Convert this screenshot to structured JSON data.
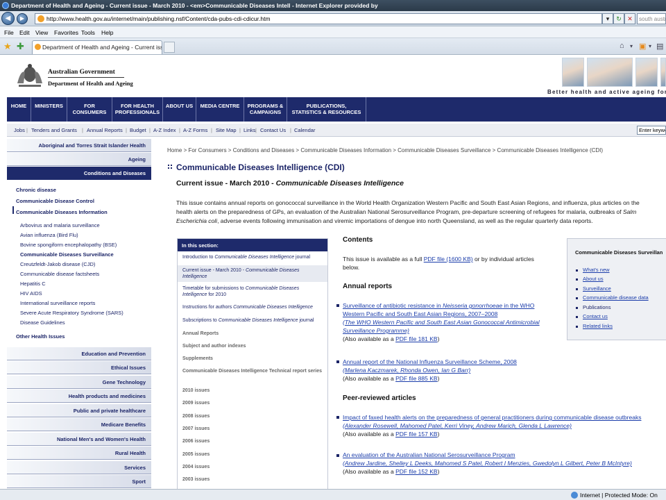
{
  "browser": {
    "title": "Department of Health and Ageing - Current issue - March 2010 - <em>Communicable Diseases Intell - Internet Explorer provided by",
    "url": "http://www.health.gov.au/internet/main/publishing.nsf/Content/cda-pubs-cdi-cdicur.htm",
    "search_placeholder": "south austra",
    "menu": [
      "File",
      "Edit",
      "View",
      "Favorites",
      "Tools",
      "Help"
    ],
    "tab_label": "Department of Health and Ageing - Current issue...",
    "status_zone": "Internet | Protected Mode: On"
  },
  "header": {
    "gov_line1": "Australian Government",
    "gov_line2": "Department of Health and Ageing",
    "tagline": "Better health and active ageing for"
  },
  "mainnav": [
    "HOME",
    "MINISTERS",
    "FOR\nCONSUMERS",
    "FOR HEALTH\nPROFESSIONALS",
    "ABOUT US",
    "MEDIA CENTRE",
    "PROGRAMS &\nCAMPAIGNS",
    "PUBLICATIONS,\nSTATISTICS & RESOURCES"
  ],
  "subnav": [
    "Jobs",
    "Tenders and Grants",
    "Annual Reports",
    "Budget",
    "A-Z Index",
    "A-Z Forms",
    "Site Map",
    "Links",
    "Contact Us",
    "Calendar"
  ],
  "keyword_placeholder": "Enter keywords",
  "sidebar": {
    "top_tabs": [
      "Aboriginal and Torres Strait Islander Health",
      "Ageing",
      "Conditions and Diseases"
    ],
    "level1_top": [
      "Chronic disease",
      "Communicable Disease Control",
      "Communicable Diseases Information"
    ],
    "level2": [
      "Arbovirus and malaria surveillance",
      "Avian influenza (Bird Flu)",
      "Bovine spongiform encephalopathy (BSE)",
      "Communicable Diseases Surveillance",
      "Creutzfeldt-Jakob disease (CJD)",
      "Communicable disease factsheets",
      "Hepatitis C",
      "HIV AIDS",
      "International surveillance reports",
      "Severe Acute Respiratory Syndrome (SARS)",
      "Disease Guidelines"
    ],
    "level1_bottom": "Other Health Issues",
    "bottom_tabs": [
      "Education and Prevention",
      "Ethical Issues",
      "Gene Technology",
      "Health products and medicines",
      "Public and private healthcare",
      "Medicare Benefits",
      "National Men's and Women's Health",
      "Rural Health",
      "Services",
      "Sport"
    ]
  },
  "content": {
    "breadcrumb": "Home > For Consumers > Conditions and Diseases > Communicable Diseases Information > Communicable Diseases Surveillance > Communicable Diseases Intelligence (CDI)",
    "title": "Communicable Diseases Intelligence (CDI)",
    "subtitle_plain": "Current issue - March 2010 - ",
    "subtitle_italic": "Communicable Diseases Intelligence",
    "intro_1": "This issue contains annual reports on gonococcal surveillance in the World Health Organization Western Pacific and South East Asian Regions, and influenza, plus articles on the",
    "intro_2": "health alerts on the preparedness of GPs, an evaluation of the Australian National Serosurveillance Program, pre-departure screening of refugees for malaria, outbreaks of ",
    "intro_2_italic": "Salm",
    "intro_3_italic": "Escherichia coli",
    "intro_3": ", adverse events following immunisation and viremic importations of dengue into north Queensland, as well as the regular quarterly data reports."
  },
  "section_box": {
    "heading": "In this section:",
    "items": [
      {
        "plain": "Introduction to ",
        "italic": "Communicable Diseases Intelligence",
        "rest": " journal"
      },
      {
        "plain": "Current issue - March 2010 - ",
        "italic": "Communicable Diseases Intelligence",
        "rest": ""
      },
      {
        "plain": "Timetable for submissions to ",
        "italic": "Communicable Diseases Intelligence",
        "rest": " for 2010"
      },
      {
        "plain": "Instructions for authors ",
        "italic": "Communicable Diseases Intelligence",
        "rest": ""
      },
      {
        "plain": "Subscriptions to ",
        "italic": "Communicable Diseases Intelligence",
        "rest": " journal"
      }
    ],
    "grey_items": [
      "Annual Reports",
      "Subject and author indexes",
      "Supplements",
      "Communicable Diseases Intelligence Technical report series",
      "2010 issues",
      "2009 issues",
      "2008 issues",
      "2007 issues",
      "2006 issues",
      "2005 issues",
      "2004 issues",
      "2003 issues"
    ]
  },
  "contents": {
    "heading": "Contents",
    "para_1": "This issue is available as a full ",
    "para_link": "PDF file (1600 KB)",
    "para_2": " or by individual articles below.",
    "annual_heading": "Annual reports",
    "peer_heading": "Peer-reviewed articles",
    "articles": [
      {
        "title_pre": "Surveillance of antibiotic resistance in ",
        "title_italic": "Neisseria gonorrhoeae",
        "title_post": " in the WHO",
        "title_line2": "Western Pacific and South East Asian Regions, 2007–2008",
        "authors_1": "(The WHO Western Pacific and South East Asian Gonococcal Antimicrobial",
        "authors_2": "Surveillance Programme)",
        "also": "(Also available as a ",
        "pdf": "PDF file 181 KB",
        "close": ")"
      },
      {
        "title": "Annual report of the National Influenza Surveillance Scheme, 2008",
        "authors": "(Marlena Kaczmarek, Rhonda Owen, Ian G Barr)",
        "also": "(Also available as a ",
        "pdf": "PDF file 885 KB",
        "close": ")"
      },
      {
        "title": "Impact of faxed health alerts on the preparedness of general practitioners during communicable disease outbreaks",
        "authors": "(Alexander Rosewell, Mahomed Patel, Kerri Viney, Andrew Marich, Glenda L Lawrence)",
        "also": "(Also available as a ",
        "pdf": "PDF file 157 KB",
        "close": ")"
      },
      {
        "title": "An evaluation of the Australian National Serosurveillance Program",
        "authors": "(Andrew Jardine, Shelley L Deeks, Mahomed S Patel, Robert I Menzies, Gwedolyn L Gilbert, Peter B McIntyre)",
        "also": "(Also available as a ",
        "pdf": "PDF file 152 KB",
        "close": ")"
      }
    ]
  },
  "right_box": {
    "heading": "Communicable Diseases Surveillan",
    "links": [
      "What's new",
      "About us",
      "Surveillance",
      "Communicable disease data",
      "Publications",
      "Contact us",
      "Related links"
    ]
  }
}
